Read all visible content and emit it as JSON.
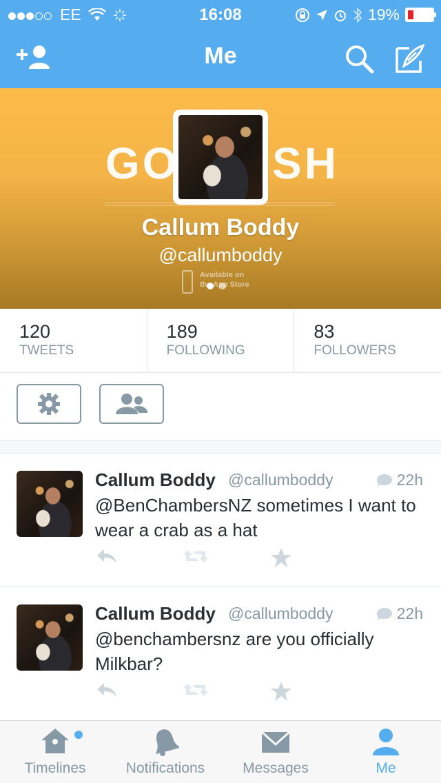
{
  "status_bar": {
    "carrier": "EE",
    "time": "16:08",
    "battery": "19%"
  },
  "nav": {
    "title": "Me"
  },
  "profile": {
    "banner_left": "GO",
    "banner_right": "SH",
    "name": "Callum Boddy",
    "handle": "@callumboddy",
    "store_line1": "Available on",
    "store_line2": "the App Store"
  },
  "stats": [
    {
      "count": "120",
      "label": "TWEETS"
    },
    {
      "count": "189",
      "label": "FOLLOWING"
    },
    {
      "count": "83",
      "label": "FOLLOWERS"
    }
  ],
  "tweets": [
    {
      "name": "Callum Boddy",
      "handle": "@callumboddy",
      "time": "22h",
      "text": "@BenChambersNZ sometimes I want to wear a crab as a hat"
    },
    {
      "name": "Callum Boddy",
      "handle": "@callumboddy",
      "time": "22h",
      "text": "@benchambersnz are you officially Milkbar?"
    }
  ],
  "tabs": [
    {
      "label": "Timelines"
    },
    {
      "label": "Notifications"
    },
    {
      "label": "Messages"
    },
    {
      "label": "Me"
    }
  ],
  "colors": {
    "brand": "#55acee",
    "banner": "#fcbb48",
    "muted": "#8899a6",
    "battery_low": "#e0242b"
  },
  "icons": [
    "add-user-icon",
    "search-icon",
    "compose-icon",
    "gear-icon",
    "people-icon",
    "reply-icon",
    "retweet-icon",
    "favorite-icon",
    "reply-bubble-icon",
    "home-icon",
    "bell-icon",
    "envelope-icon",
    "person-icon"
  ]
}
